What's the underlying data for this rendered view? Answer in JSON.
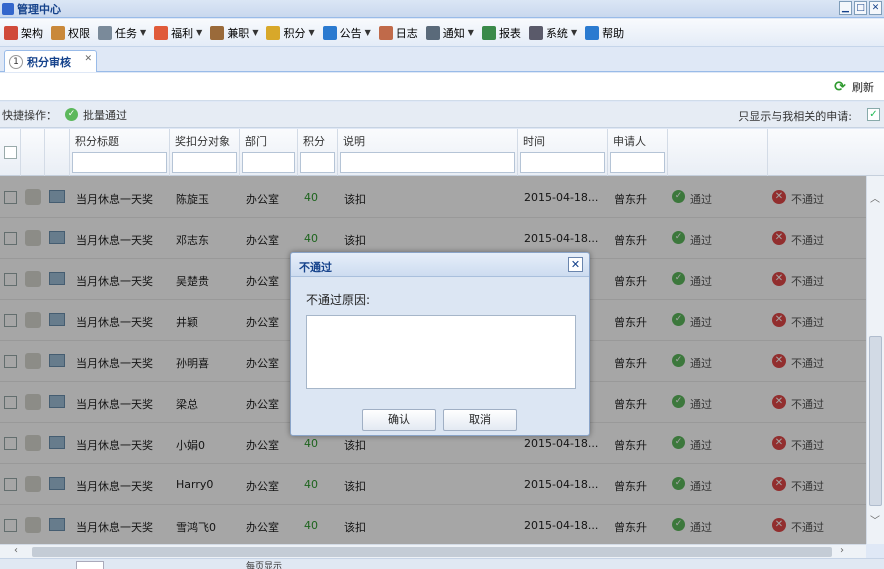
{
  "window": {
    "title": "管理中心"
  },
  "menu": [
    {
      "label": "架构",
      "icon": "org-chart-icon",
      "color": "#d04a3a",
      "caret": false
    },
    {
      "label": "权限",
      "icon": "users-icon",
      "color": "#c9883a",
      "caret": false
    },
    {
      "label": "任务",
      "icon": "clipboard-icon",
      "color": "#7a8a9a",
      "caret": true
    },
    {
      "label": "福利",
      "icon": "heart-icon",
      "color": "#e05a3a",
      "caret": true
    },
    {
      "label": "兼职",
      "icon": "briefcase-icon",
      "color": "#9a6a3a",
      "caret": true
    },
    {
      "label": "积分",
      "icon": "coins-icon",
      "color": "#d8a82a",
      "caret": true
    },
    {
      "label": "公告",
      "icon": "info-icon",
      "color": "#2a7ad0",
      "caret": true
    },
    {
      "label": "日志",
      "icon": "notebook-icon",
      "color": "#c06a4a",
      "caret": false
    },
    {
      "label": "通知",
      "icon": "speaker-icon",
      "color": "#5a6a7a",
      "caret": true
    },
    {
      "label": "报表",
      "icon": "bar-report-icon",
      "color": "#3a8a4a",
      "caret": false
    },
    {
      "label": "系统",
      "icon": "system-icon",
      "color": "#5a5a6a",
      "caret": true
    },
    {
      "label": "帮助",
      "icon": "help-icon",
      "color": "#2a7ad0",
      "caret": false
    }
  ],
  "tab": {
    "number": "1",
    "label": "积分审核"
  },
  "toolbar": {
    "refresh_label": "刷新"
  },
  "quick": {
    "label": "快捷操作：",
    "batch_label": "批量通过",
    "only_mine_label": "只显示与我相关的申请:",
    "only_mine_checked": "✓"
  },
  "columns": [
    "积分标题",
    "奖扣分对象",
    "部门",
    "积分",
    "说明",
    "时间",
    "申请人"
  ],
  "rows": [
    {
      "title": "当月休息一天奖",
      "target": "陈旋玉",
      "dept": "办公室",
      "points": "40",
      "note": "该扣",
      "time": "2015-04-18...",
      "applicant": "曾东升",
      "pass": "通过",
      "fail": "不通过"
    },
    {
      "title": "当月休息一天奖",
      "target": "邓志东",
      "dept": "办公室",
      "points": "40",
      "note": "该扣",
      "time": "2015-04-18...",
      "applicant": "曾东升",
      "pass": "通过",
      "fail": "不通过"
    },
    {
      "title": "当月休息一天奖",
      "target": "吴楚贵",
      "dept": "办公室",
      "points": "",
      "note": "",
      "time": "",
      "applicant": "曾东升",
      "pass": "通过",
      "fail": "不通过"
    },
    {
      "title": "当月休息一天奖",
      "target": "井颖",
      "dept": "办公室",
      "points": "",
      "note": "",
      "time": "",
      "applicant": "曾东升",
      "pass": "通过",
      "fail": "不通过"
    },
    {
      "title": "当月休息一天奖",
      "target": "孙明喜",
      "dept": "办公室",
      "points": "",
      "note": "",
      "time": "",
      "applicant": "曾东升",
      "pass": "通过",
      "fail": "不通过"
    },
    {
      "title": "当月休息一天奖",
      "target": "梁总",
      "dept": "办公室",
      "points": "",
      "note": "",
      "time": "",
      "applicant": "曾东升",
      "pass": "通过",
      "fail": "不通过"
    },
    {
      "title": "当月休息一天奖",
      "target": "小娟0",
      "dept": "办公室",
      "points": "40",
      "note": "该扣",
      "time": "2015-04-18...",
      "applicant": "曾东升",
      "pass": "通过",
      "fail": "不通过"
    },
    {
      "title": "当月休息一天奖",
      "target": "Harry0",
      "dept": "办公室",
      "points": "40",
      "note": "该扣",
      "time": "2015-04-18...",
      "applicant": "曾东升",
      "pass": "通过",
      "fail": "不通过"
    },
    {
      "title": "当月休息一天奖",
      "target": "雪鸿飞0",
      "dept": "办公室",
      "points": "40",
      "note": "该扣",
      "time": "2015-04-18...",
      "applicant": "曾东升",
      "pass": "通过",
      "fail": "不通过"
    }
  ],
  "dialog": {
    "title": "不通过",
    "reason_label": "不通过原因:",
    "reason_value": "",
    "confirm_label": "确认",
    "cancel_label": "取消"
  },
  "pager": {
    "note": "每页显示"
  }
}
